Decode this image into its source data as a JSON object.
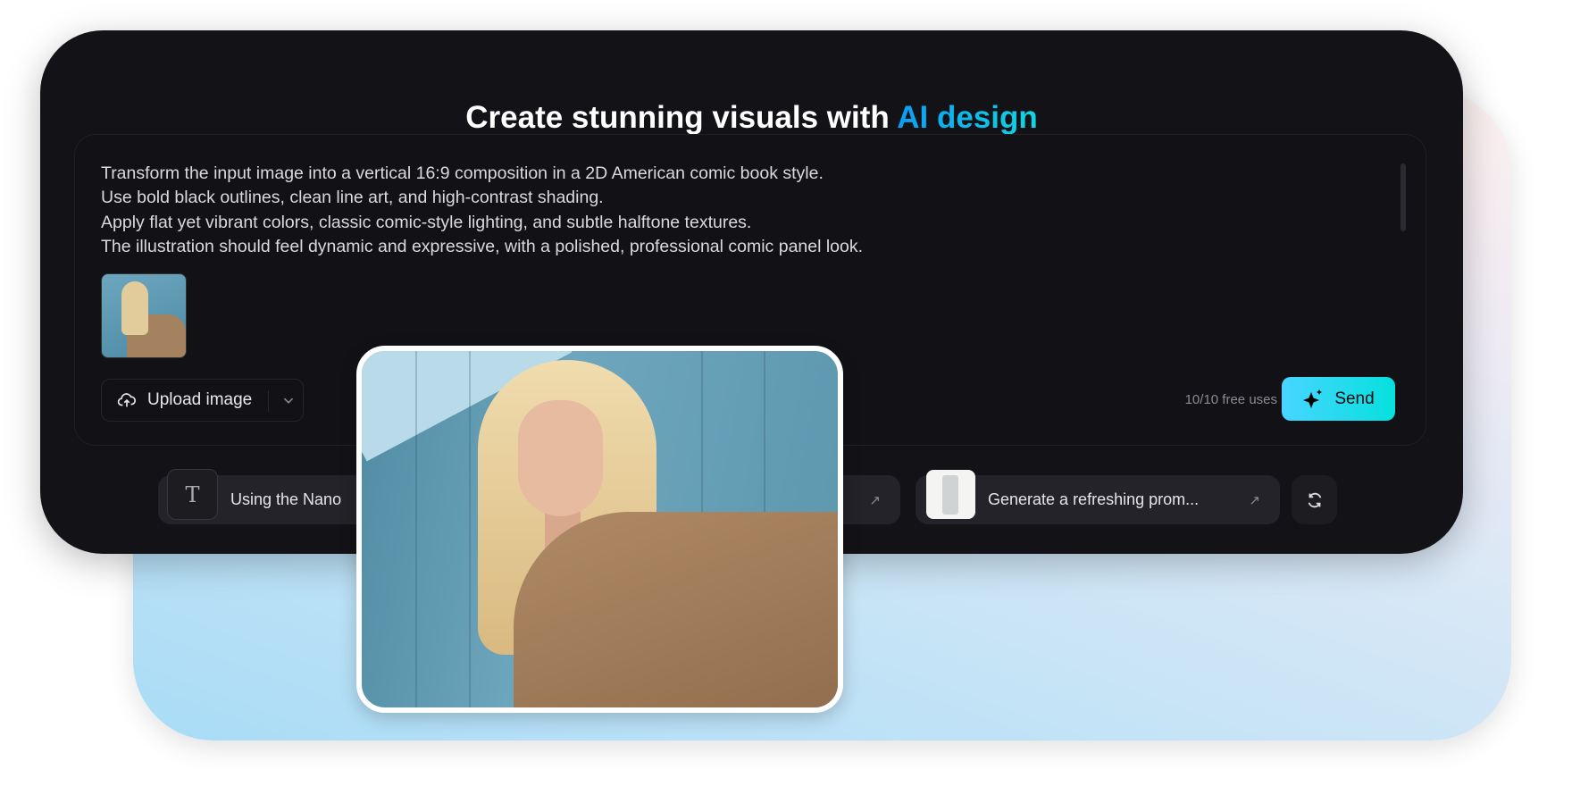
{
  "header": {
    "title_prefix": "Create stunning visuals with ",
    "title_highlight": "AI design"
  },
  "prompt": {
    "lines": [
      "Transform the input image into a vertical 16:9 composition in a 2D American comic book style.",
      "Use bold black outlines, clean line art, and high-contrast shading.",
      "Apply flat yet vibrant colors, classic comic-style lighting, and subtle halftone textures.",
      "The illustration should feel dynamic and expressive, with a polished, professional comic panel look."
    ]
  },
  "toolbar": {
    "upload_label": "Upload image",
    "free_uses": "10/10 free uses",
    "send_label": "Send"
  },
  "suggestions": [
    {
      "icon": "T",
      "text": "Using the Nano"
    },
    {
      "text": "Generate a refreshing prom..."
    }
  ],
  "colors": {
    "accent_start": "#48d5ff",
    "accent_end": "#06e0dd",
    "card_bg": "#131317"
  }
}
